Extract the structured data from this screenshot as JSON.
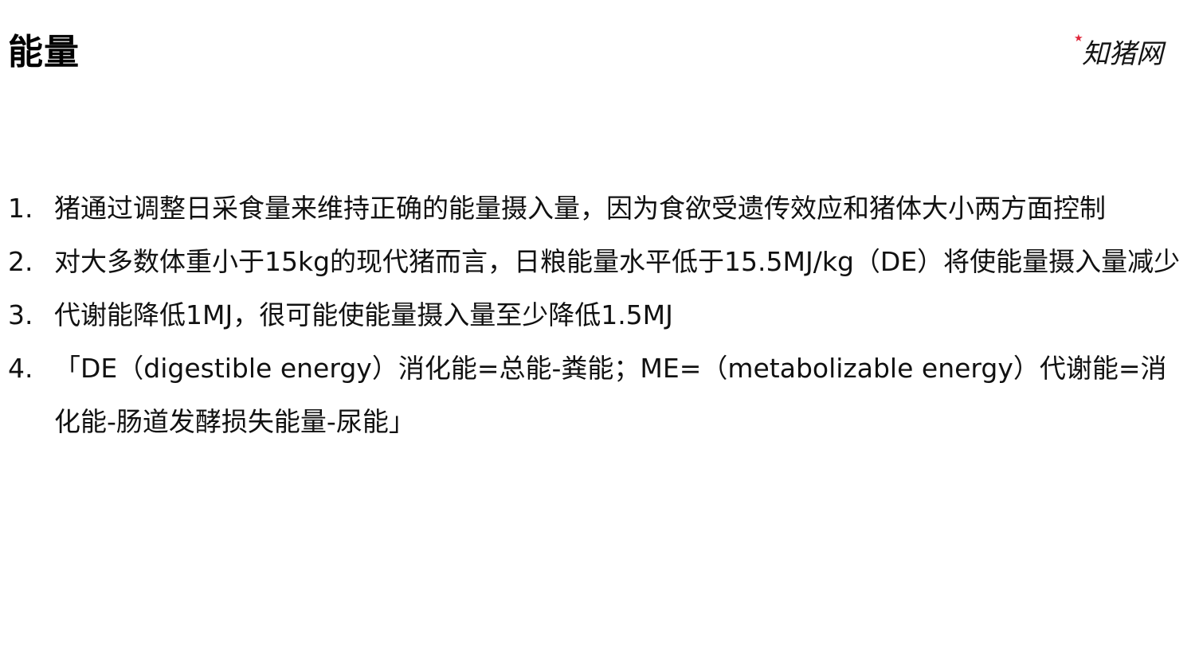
{
  "title": "能量",
  "logo": {
    "text": "知猪网",
    "icon": "star-icon",
    "star_color": "#e0283c"
  },
  "items": [
    {
      "number": "1.",
      "text": "猪通过调整日采食量来维持正确的能量摄入量，因为食欲受遗传效应和猪体大小两方面控制"
    },
    {
      "number": "2.",
      "text": "对大多数体重小于15kg的现代猪而言，日粮能量水平低于15.5MJ/kg（DE）将使能量摄入量减少"
    },
    {
      "number": "3.",
      "text": "代谢能降低1MJ，很可能使能量摄入量至少降低1.5MJ"
    },
    {
      "number": "4.",
      "text": "「DE（digestible energy）消化能=总能-粪能；ME=（metabolizable energy）代谢能=消化能-肠道发酵损失能量-尿能」"
    }
  ]
}
